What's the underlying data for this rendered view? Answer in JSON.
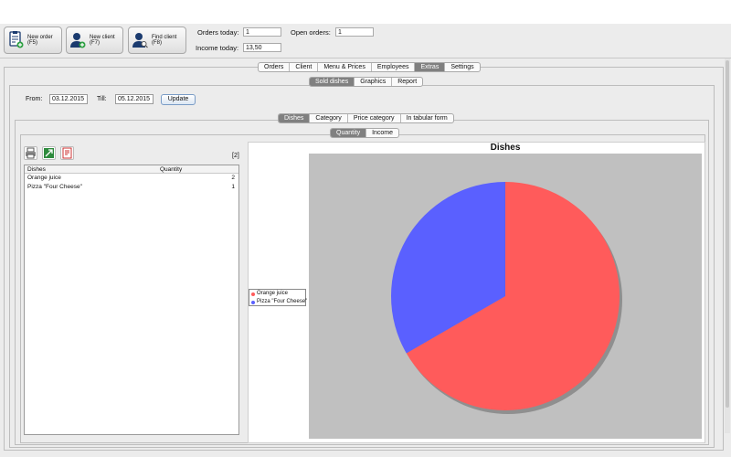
{
  "toolbar": {
    "new_order": "New order (F5)",
    "new_client": "New client (F7)",
    "find_client": "Find client (F8)"
  },
  "stats": {
    "orders_today_label": "Orders today:",
    "orders_today_value": "1",
    "open_orders_label": "Open orders:",
    "open_orders_value": "1",
    "income_today_label": "Income today:",
    "income_today_value": "13,50"
  },
  "main_tabs": [
    {
      "label": "Orders",
      "selected": false
    },
    {
      "label": "Client",
      "selected": false
    },
    {
      "label": "Menu & Prices",
      "selected": false
    },
    {
      "label": "Employees",
      "selected": false
    },
    {
      "label": "Extras",
      "selected": true
    },
    {
      "label": "Settings",
      "selected": false
    }
  ],
  "sub_tabs": [
    {
      "label": "Sold dishes",
      "selected": true
    },
    {
      "label": "Graphics",
      "selected": false
    },
    {
      "label": "Report",
      "selected": false
    }
  ],
  "filter": {
    "from_label": "From:",
    "from_value": "03.12.2015",
    "till_label": "Till:",
    "till_value": "05.12.2015",
    "update_label": "Update"
  },
  "category_tabs": [
    {
      "label": "Dishes",
      "selected": true
    },
    {
      "label": "Category",
      "selected": false
    },
    {
      "label": "Price category",
      "selected": false
    },
    {
      "label": "In tabular form",
      "selected": false
    }
  ],
  "metric_tabs": [
    {
      "label": "Quantity",
      "selected": true
    },
    {
      "label": "Income",
      "selected": false
    }
  ],
  "list": {
    "count": "[2]",
    "col_dishes": "Dishes",
    "col_quantity": "Quantity",
    "rows": [
      {
        "dish": "Orange juice",
        "quantity": "2"
      },
      {
        "dish": "Pizza \"Four Cheese\"",
        "quantity": "1"
      }
    ]
  },
  "icons": {
    "print": "print-icon",
    "export_excel": "excel-export-icon",
    "export_pdf": "pdf-export-icon"
  },
  "chart_data": {
    "type": "pie",
    "title": "Dishes",
    "categories": [
      "Orange juice",
      "Pizza \"Four Cheese\""
    ],
    "values": [
      2,
      1
    ],
    "colors": [
      "#ff5b5b",
      "#5a60ff"
    ],
    "legend": "left"
  }
}
